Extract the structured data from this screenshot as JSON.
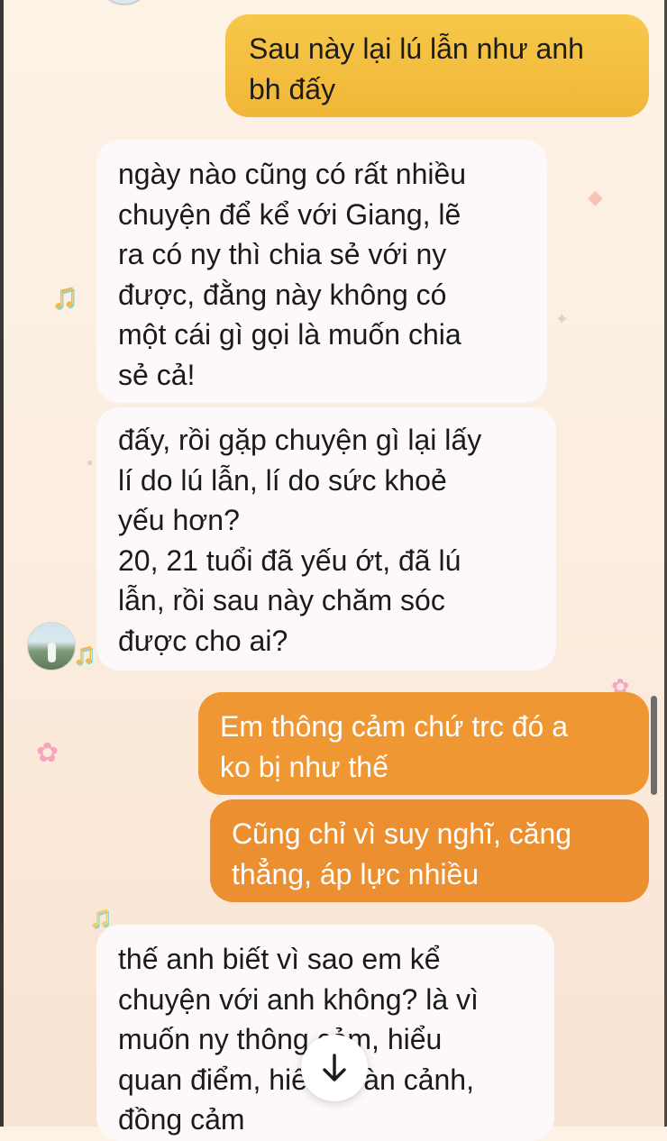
{
  "messages": [
    {
      "id": "b1",
      "direction": "outgoing",
      "text": "Sau này lại lú lẫn như anh\nbh đấy"
    },
    {
      "id": "b2",
      "direction": "incoming",
      "text": "ngày nào cũng có rất nhiều\nchuyện để kể với Giang, lẽ\nra có ny thì chia sẻ với ny\nđược, đằng này không có\nmột cái gì gọi là muốn chia\nsẻ cả!"
    },
    {
      "id": "b3",
      "direction": "incoming",
      "text": "đấy, rồi gặp chuyện gì lại lấy\nlí do lú lẫn, lí do sức khoẻ\nyếu hơn?\n20, 21 tuổi đã yếu ớt, đã lú\nlẫn, rồi sau này chăm sóc\nđược cho ai?"
    },
    {
      "id": "b4",
      "direction": "outgoing",
      "text": "Em thông cảm chứ trc đó a\nko bị như thế"
    },
    {
      "id": "b5",
      "direction": "outgoing",
      "text": "Cũng chỉ vì suy nghĩ, căng\nthẳng, áp lực nhiều"
    },
    {
      "id": "b6",
      "direction": "incoming",
      "text": "thế anh biết vì sao em kể\nchuyện với anh không? là vì\nmuốn ny thông cảm, hiểu\nquan điểm, hiểu hoàn cảnh,\nđồng cảm"
    }
  ],
  "icons": {
    "scroll_down": "arrow-down-icon",
    "music_note": "music-note-icon",
    "flower": "flower-icon"
  },
  "colors": {
    "outgoing_yellow": "#f3bd40",
    "outgoing_orange": "#ef9733",
    "incoming": "#fdf9fb",
    "background": "#fbeee0"
  }
}
